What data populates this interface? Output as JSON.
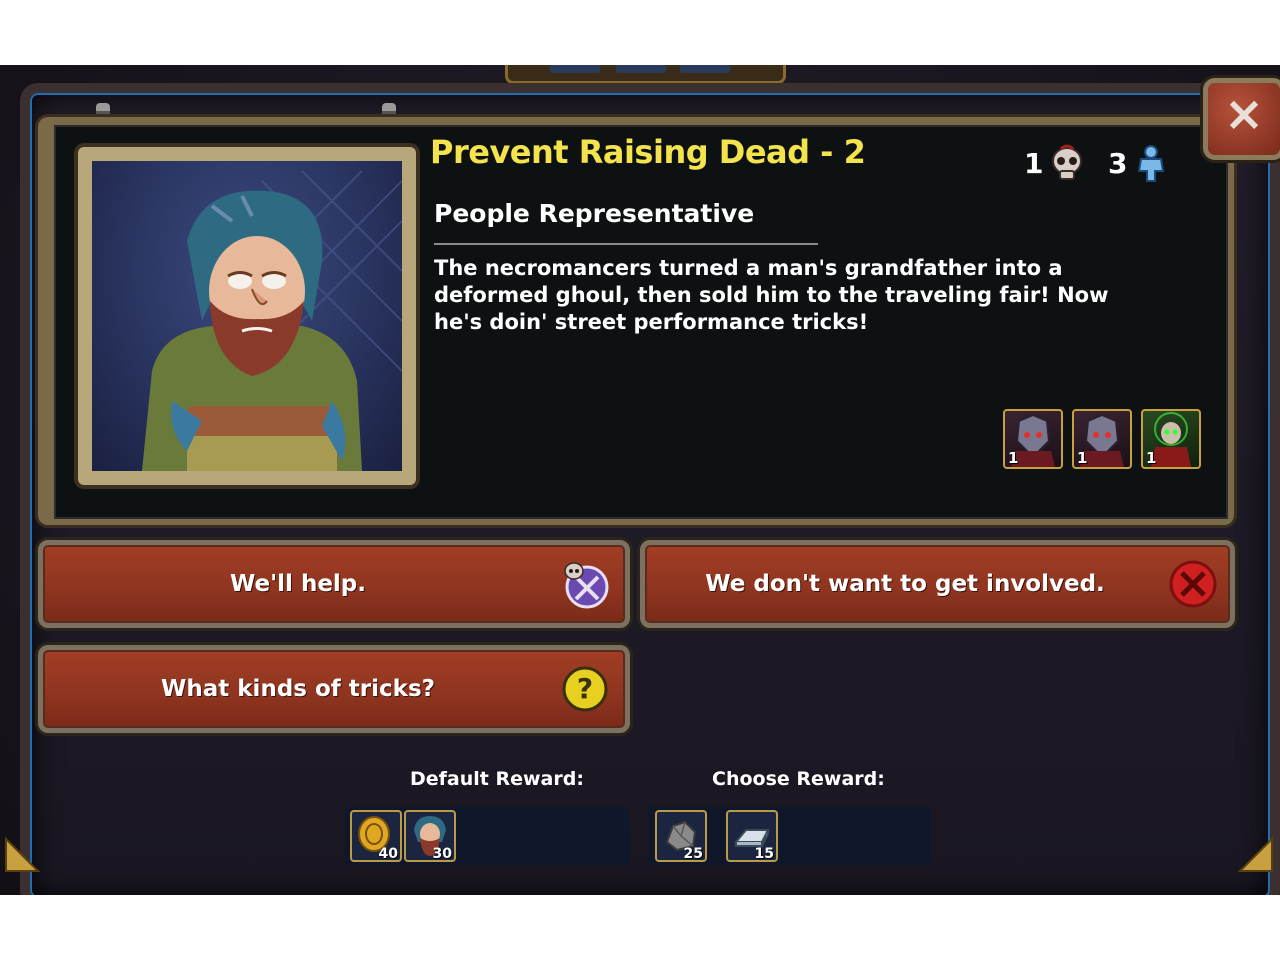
{
  "dialog": {
    "title": "Prevent Raising Dead - 2",
    "subtitle": "People Representative",
    "description": "The necromancers turned a man's grandfather into a deformed ghoul, then sold him to the traveling fair! Now he's doin' street performance tricks!",
    "close_label": "×"
  },
  "stats": {
    "skulls": "1",
    "units": "3"
  },
  "enemies": [
    {
      "count": "1",
      "icon": "armored-undead-knight"
    },
    {
      "count": "1",
      "icon": "armored-undead-knight"
    },
    {
      "count": "1",
      "icon": "necromancer-skull-mage"
    }
  ],
  "options": {
    "help": {
      "label": "We'll help.",
      "icon": "skull-crossed-swords-icon"
    },
    "decline": {
      "label": "We don't want to get involved.",
      "icon": "red-x-icon"
    },
    "ask": {
      "label": "What kinds of tricks?",
      "icon": "question-mark-icon"
    }
  },
  "rewards": {
    "default_label": "Default Reward:",
    "choose_label": "Choose Reward:",
    "default_items": [
      {
        "icon": "gold-coin",
        "count": "40"
      },
      {
        "icon": "peasant-portrait",
        "count": "30"
      }
    ],
    "choose_items": [
      {
        "icon": "stone-ore",
        "count": "25"
      },
      {
        "icon": "iron-ingot",
        "count": "15"
      }
    ]
  },
  "colors": {
    "title": "#f3e34c",
    "button": "#8e3420",
    "frame_accent": "#1f6fb0"
  }
}
